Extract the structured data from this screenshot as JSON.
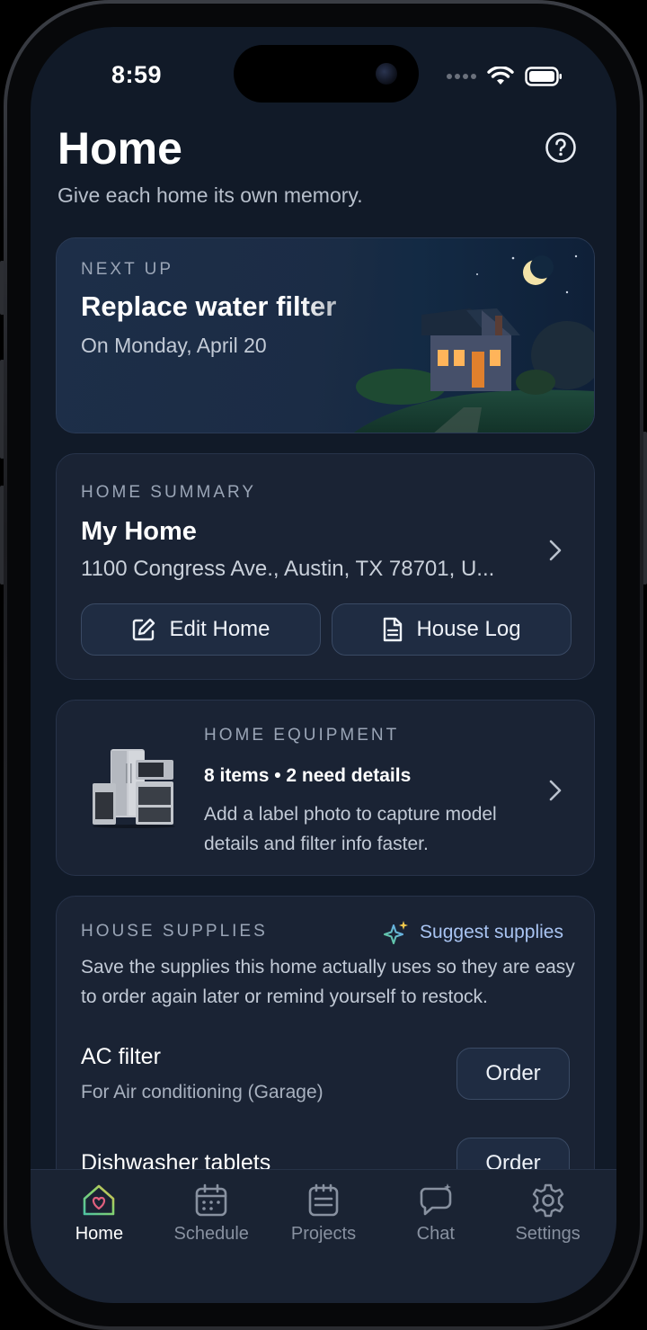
{
  "status": {
    "time": "8:59"
  },
  "header": {
    "title": "Home",
    "subtitle": "Give each home its own memory."
  },
  "next_up": {
    "eyebrow": "NEXT UP",
    "task": "Replace water filter",
    "date": "On Monday, April 20"
  },
  "summary": {
    "eyebrow": "HOME SUMMARY",
    "name": "My Home",
    "address": "1100 Congress Ave., Austin, TX 78701, U...",
    "edit_label": "Edit Home",
    "log_label": "House Log"
  },
  "equipment": {
    "eyebrow": "HOME EQUIPMENT",
    "count": "8 items • 2 need details",
    "description": "Add a label photo to capture model details and filter info faster."
  },
  "supplies": {
    "eyebrow": "HOUSE SUPPLIES",
    "suggest_label": "Suggest supplies",
    "description": "Save the supplies this home actually uses so they are easy to order again later or remind yourself to restock.",
    "items": [
      {
        "name": "AC filter",
        "sub": "For Air conditioning (Garage)",
        "order_label": "Order"
      },
      {
        "name": "Dishwasher tablets",
        "sub": "",
        "order_label": "Order"
      }
    ]
  },
  "tabs": [
    {
      "label": "Home",
      "icon": "home-heart-icon",
      "active": true
    },
    {
      "label": "Schedule",
      "icon": "calendar-icon",
      "active": false
    },
    {
      "label": "Projects",
      "icon": "notepad-icon",
      "active": false
    },
    {
      "label": "Chat",
      "icon": "chat-bubble-icon",
      "active": false
    },
    {
      "label": "Settings",
      "icon": "gear-icon",
      "active": false
    }
  ],
  "colors": {
    "background": "#111a28",
    "card": "#1a2334",
    "accent": "#a9c4f2",
    "muted": "#8891a0"
  }
}
